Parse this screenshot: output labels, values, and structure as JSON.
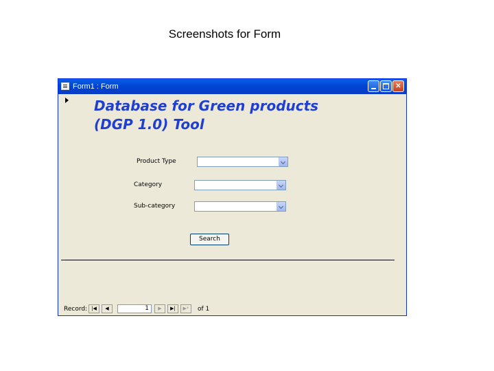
{
  "slide": {
    "title": "Screenshots for Form"
  },
  "window": {
    "title": "Form1 : Form",
    "icons": {
      "form": "form-icon",
      "minimize": "minimize-icon",
      "maximize": "maximize-icon",
      "close": "close-icon"
    },
    "close_glyph": "✕"
  },
  "form": {
    "heading": "Database for Green products\n(DGP 1.0) Tool",
    "heading_color": "#1f3fd1",
    "fields": [
      {
        "label": "Product Type",
        "value": ""
      },
      {
        "label": "Category",
        "value": ""
      },
      {
        "label": "Sub-category",
        "value": ""
      }
    ],
    "search_label": "Search"
  },
  "record_nav": {
    "label": "Record:",
    "first": "|◀",
    "prev": "◀",
    "current": "1",
    "next": "▶",
    "last": "▶|",
    "new": "▶*",
    "total_text": "of 1"
  }
}
